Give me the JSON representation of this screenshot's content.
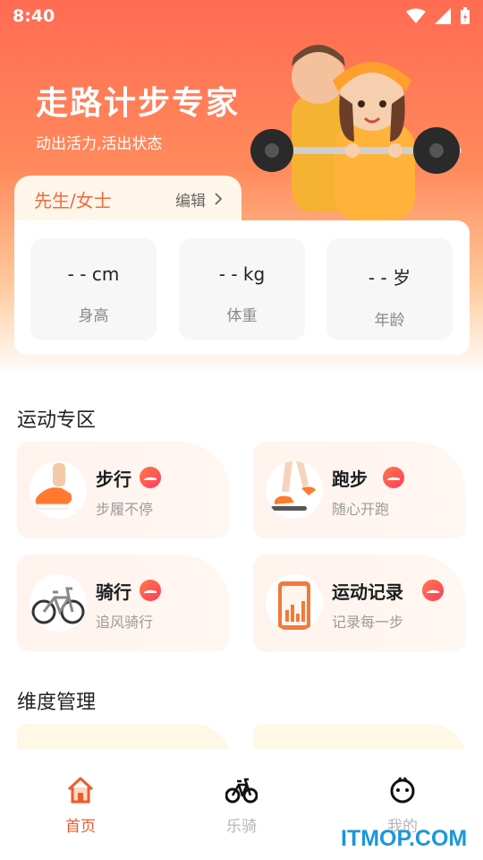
{
  "status_bar": {
    "time": "8:40"
  },
  "header": {
    "title": "走路计步专家",
    "subtitle": "动出活力,活出状态"
  },
  "profile": {
    "name": "先生/女士",
    "edit_label": "编辑",
    "stats": [
      {
        "value": "- - cm",
        "label": "身高"
      },
      {
        "value": "- - kg",
        "label": "体重"
      },
      {
        "value": "- - 岁",
        "label": "年龄"
      }
    ]
  },
  "sports_section": {
    "title": "运动专区",
    "cards": [
      {
        "name": "步行",
        "desc": "步履不停",
        "icon": "walking-shoe-icon"
      },
      {
        "name": "跑步",
        "desc": "随心开跑",
        "icon": "running-legs-icon"
      },
      {
        "name": "骑行",
        "desc": "追风骑行",
        "icon": "bicycle-icon"
      },
      {
        "name": "运动记录",
        "desc": "记录每一步",
        "icon": "phone-stats-icon"
      }
    ]
  },
  "dimension_section": {
    "title": "维度管理"
  },
  "tabbar": {
    "items": [
      {
        "label": "首页",
        "icon": "home-icon",
        "active": true
      },
      {
        "label": "乐骑",
        "icon": "bike-icon",
        "active": false
      },
      {
        "label": "我的",
        "icon": "face-icon",
        "active": false
      }
    ]
  },
  "watermark": "ITMOP.COM",
  "colors": {
    "accent": "#ef5a2a",
    "hero_top": "#ff6b52",
    "card_bg": "#fff3ee"
  }
}
